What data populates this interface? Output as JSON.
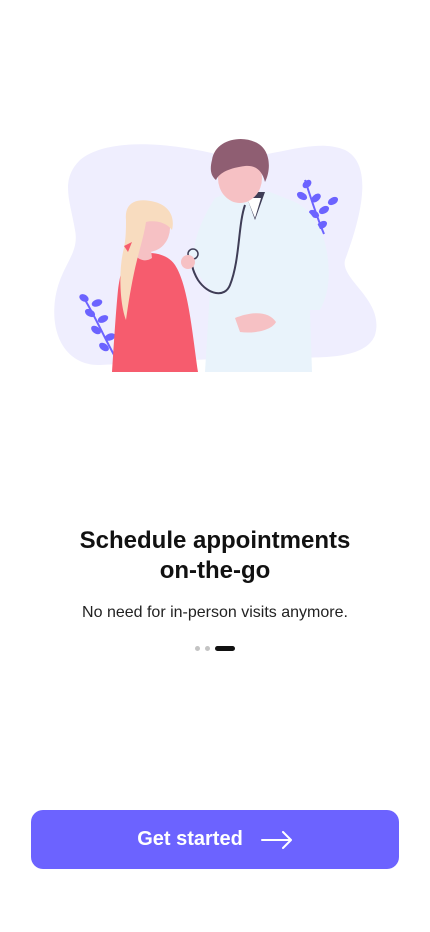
{
  "onboarding": {
    "title_line1": "Schedule appointments",
    "title_line2": "on-the-go",
    "subtitle": "No need for in-person visits anymore.",
    "page_indicator": {
      "total": 3,
      "active": 3
    },
    "cta_label": "Get started"
  },
  "colors": {
    "accent": "#6c63ff",
    "blob": "#efeefe",
    "patient_shirt": "#f65c6e",
    "doctor_coat": "#e9f3fb",
    "hair_doctor": "#8f5e72",
    "hair_patient": "#f8dcbf",
    "skin": "#f6c1c4",
    "leaves": "#6c63ff"
  },
  "icons": {
    "cta_icon": "arrow-right-icon",
    "illustration": "doctor-patient-illustration"
  }
}
